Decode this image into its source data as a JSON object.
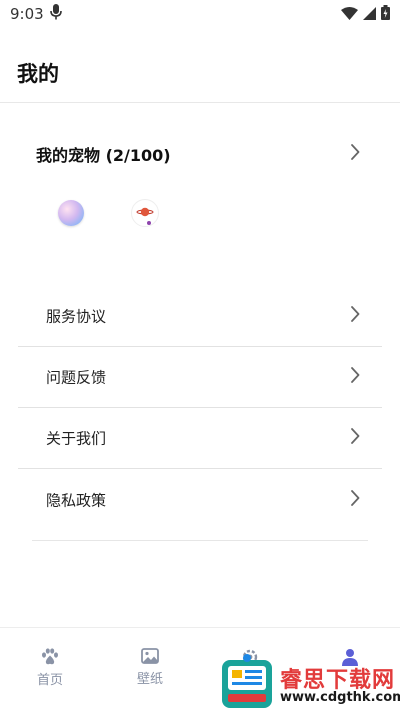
{
  "status_bar": {
    "time": "9:03",
    "icons": [
      "microphone-icon",
      "wifi-icon",
      "cellular-signal-icon",
      "battery-icon"
    ]
  },
  "header": {
    "title": "我的"
  },
  "pets": {
    "title": "我的宠物 (2/100)",
    "items": [
      {
        "icon": "pearl-orb-pet-icon"
      },
      {
        "icon": "planet-pet-icon"
      }
    ]
  },
  "menu": {
    "items": [
      {
        "label": "服务协议"
      },
      {
        "label": "问题反馈"
      },
      {
        "label": "关于我们"
      },
      {
        "label": "隐私政策"
      }
    ]
  },
  "bottom_nav": {
    "items": [
      {
        "label": "首页",
        "icon": "paw-icon"
      },
      {
        "label": "壁纸",
        "icon": "image-icon"
      },
      {
        "label": "",
        "icon": "settings-icon"
      },
      {
        "label": "",
        "icon": "user-icon",
        "active": true
      }
    ]
  },
  "watermark": {
    "title": "睿思下载网",
    "url": "www.cdgthk.com"
  },
  "colors": {
    "nav_inactive": "#8a93a6",
    "nav_active": "#5b5fd6",
    "watermark_red": "#e23b3b",
    "divider": "#e2e2e2"
  }
}
